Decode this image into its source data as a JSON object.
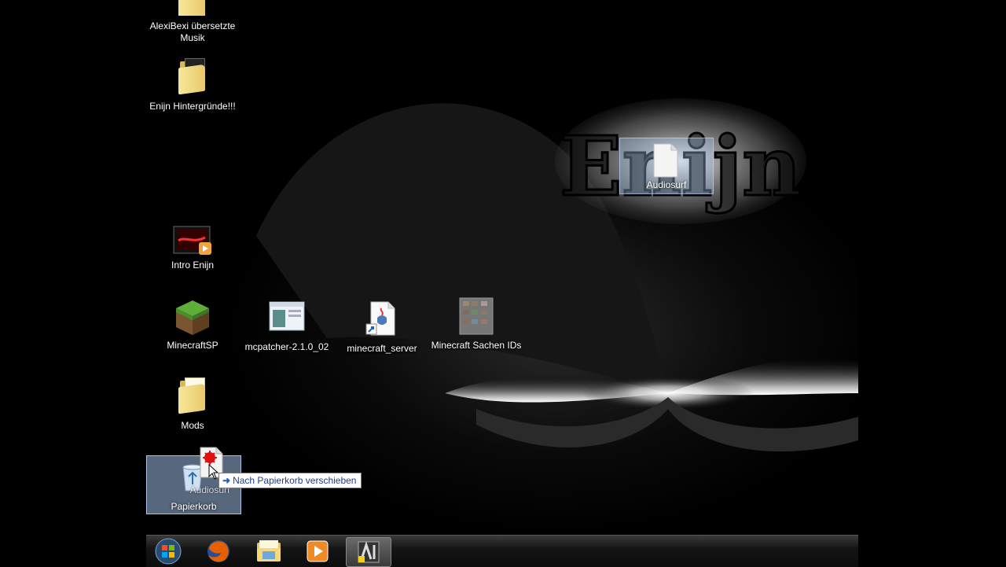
{
  "desktop": {
    "icons": [
      {
        "label": "AlexiBexi übersetzte Musik",
        "icon": "folder-icon"
      },
      {
        "label": "Enijn Hintergründe!!!",
        "icon": "folder-icon"
      },
      {
        "label": "Intro Enijn",
        "icon": "video-icon"
      },
      {
        "label": "MinecraftSP",
        "icon": "minecraft-grass-block-icon"
      },
      {
        "label": "mcpatcher-2.1.0_02",
        "icon": "application-window-icon"
      },
      {
        "label": "minecraft_server",
        "icon": "java-shortcut-icon"
      },
      {
        "label": "Minecraft Sachen IDs",
        "icon": "image-thumbnail-icon"
      },
      {
        "label": "Mods",
        "icon": "folder-icon"
      },
      {
        "label": "Papierkorb",
        "icon": "recycle-bin-icon"
      }
    ],
    "dragged_file_label": "Audiosurf",
    "drag_ghost_label": "Audiosurf",
    "tooltip": "Nach Papierkorb verschieben",
    "wallpaper_logo": "Enijn"
  },
  "taskbar": {
    "buttons": [
      {
        "icon": "windows-start-icon"
      },
      {
        "icon": "firefox-icon"
      },
      {
        "icon": "file-explorer-icon"
      },
      {
        "icon": "media-player-icon"
      },
      {
        "icon": "active-app-icon"
      }
    ]
  },
  "colors": {
    "tooltip_text": "#1e3d8f",
    "selection": "#a9c4e6"
  }
}
